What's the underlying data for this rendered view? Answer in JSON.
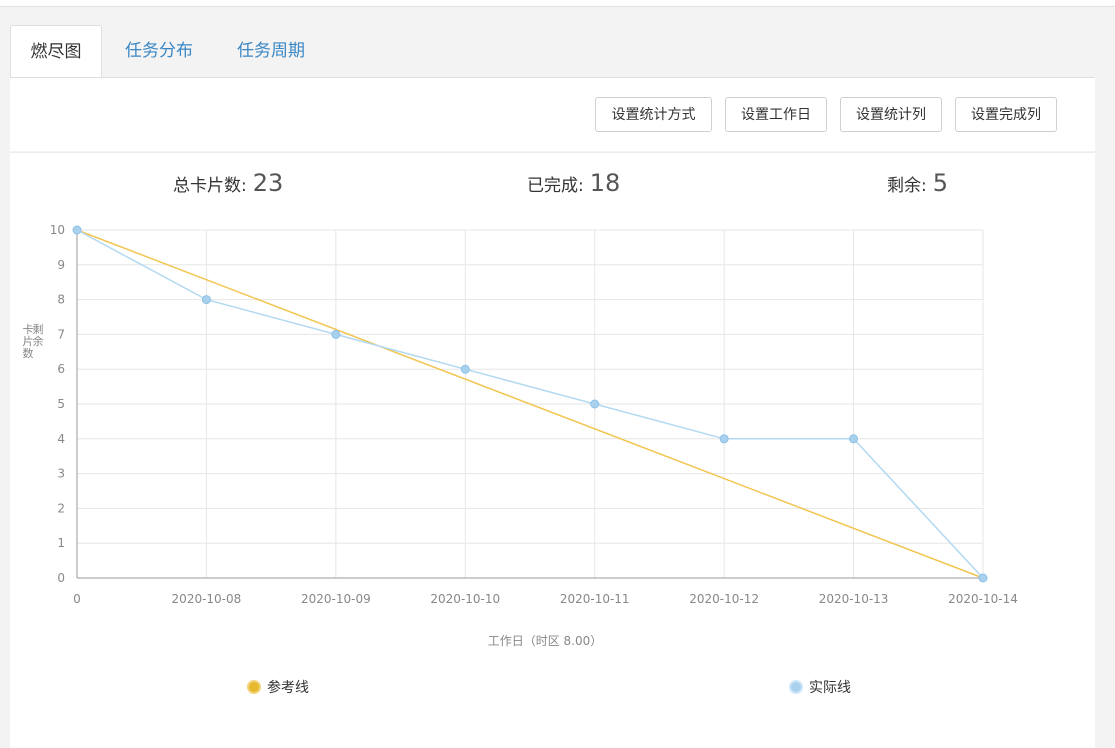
{
  "tabs": [
    {
      "label": "燃尽图",
      "active": true
    },
    {
      "label": "任务分布",
      "active": false
    },
    {
      "label": "任务周期",
      "active": false
    }
  ],
  "toolbar": {
    "buttons": [
      "设置统计方式",
      "设置工作日",
      "设置统计列",
      "设置完成列"
    ]
  },
  "stats": {
    "total_label": "总卡片数:",
    "total_value": "23",
    "done_label": "已完成:",
    "done_value": "18",
    "remain_label": "剩余:",
    "remain_value": "5"
  },
  "chart_data": {
    "type": "line",
    "categories": [
      "0",
      "2020-10-08",
      "2020-10-09",
      "2020-10-10",
      "2020-10-11",
      "2020-10-12",
      "2020-10-13",
      "2020-10-14"
    ],
    "series": [
      {
        "name": "参考线",
        "values": [
          10,
          null,
          null,
          null,
          null,
          null,
          null,
          0
        ],
        "color": "#f1c550"
      },
      {
        "name": "实际线",
        "values": [
          10,
          8,
          7,
          6,
          5,
          4,
          4,
          0
        ],
        "color": "#b3d9f2"
      }
    ],
    "ylim": [
      0,
      10
    ],
    "yticks": [
      0,
      1,
      2,
      3,
      4,
      5,
      6,
      7,
      8,
      9,
      10
    ],
    "xlabel": "工作日（时区 8.00）",
    "ylabel": "剩余卡片数",
    "grid": true,
    "legend_position": "bottom",
    "legend_colors": [
      "#e6b82c",
      "#a9d1ee"
    ]
  }
}
